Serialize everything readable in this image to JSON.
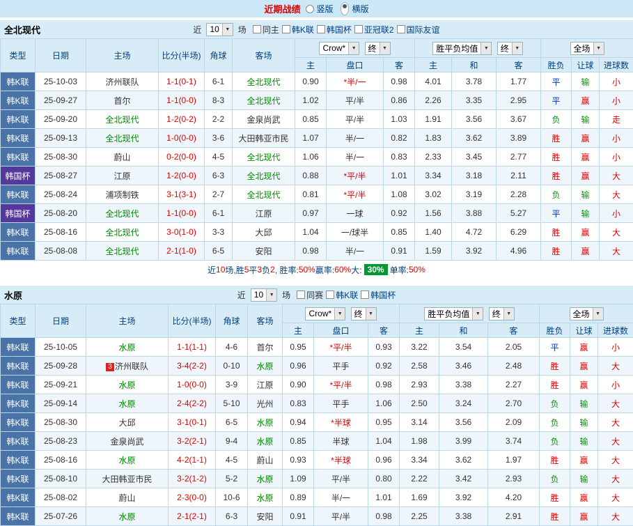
{
  "topbar": {
    "title": "近期战绩",
    "layout_options": [
      {
        "label": "竖版",
        "selected": false
      },
      {
        "label": "横版",
        "selected": true
      }
    ]
  },
  "sections": [
    {
      "team": "全北现代",
      "controls": {
        "near": "近",
        "count": "10",
        "games": "场",
        "filters": [
          {
            "label": "同主",
            "checked": false,
            "type": "plain"
          },
          {
            "label": "韩K联",
            "checked": false,
            "type": "league"
          },
          {
            "label": "韩国杯",
            "checked": false,
            "type": "league"
          },
          {
            "label": "亚冠联2",
            "checked": false,
            "type": "league"
          },
          {
            "label": "国际友谊",
            "checked": false,
            "type": "league"
          }
        ]
      },
      "header": {
        "type": "类型",
        "date": "日期",
        "home": "主场",
        "score": "比分(半场)",
        "corner": "角球",
        "away": "客场",
        "odds_select": "Crow*",
        "odds_final": "终",
        "avg_select": "胜平负均值",
        "avg_final": "终",
        "full_select": "全场",
        "odds_sub": [
          "主",
          "盘口",
          "客"
        ],
        "avg_sub": [
          "主",
          "和",
          "客"
        ],
        "full_sub": [
          "胜负",
          "让球",
          "进球数"
        ]
      },
      "rows": [
        {
          "league": "韩K联",
          "cup": false,
          "date": "25-10-03",
          "home": "济州联队",
          "home_focus": false,
          "badge": "",
          "score": "1-1(0-1)",
          "corner": "6-1",
          "away": "全北现代",
          "away_focus": true,
          "odds_home": "0.90",
          "handicap": "*半/一",
          "handicap_star": true,
          "odds_away": "0.98",
          "avg": [
            "4.01",
            "3.78",
            "1.77"
          ],
          "result": [
            "平",
            "blue"
          ],
          "handicap_result": [
            "输",
            "green"
          ],
          "goals_result": [
            "小",
            "red"
          ]
        },
        {
          "league": "韩K联",
          "cup": false,
          "date": "25-09-27",
          "home": "首尔",
          "home_focus": false,
          "badge": "",
          "score": "1-1(0-0)",
          "corner": "8-3",
          "away": "全北现代",
          "away_focus": true,
          "odds_home": "1.02",
          "handicap": "平/半",
          "handicap_star": false,
          "odds_away": "0.86",
          "avg": [
            "2.26",
            "3.35",
            "2.95"
          ],
          "result": [
            "平",
            "blue"
          ],
          "handicap_result": [
            "赢",
            "red"
          ],
          "goals_result": [
            "小",
            "red"
          ]
        },
        {
          "league": "韩K联",
          "cup": false,
          "date": "25-09-20",
          "home": "全北现代",
          "home_focus": true,
          "badge": "",
          "score": "1-2(0-2)",
          "corner": "2-2",
          "away": "金泉尚武",
          "away_focus": false,
          "odds_home": "0.85",
          "handicap": "平/半",
          "handicap_star": false,
          "odds_away": "1.03",
          "avg": [
            "1.91",
            "3.56",
            "3.67"
          ],
          "result": [
            "负",
            "green"
          ],
          "handicap_result": [
            "输",
            "green"
          ],
          "goals_result": [
            "走",
            "red"
          ]
        },
        {
          "league": "韩K联",
          "cup": false,
          "date": "25-09-13",
          "home": "全北现代",
          "home_focus": true,
          "badge": "",
          "score": "1-0(0-0)",
          "corner": "3-6",
          "away": "大田韩亚市民",
          "away_focus": false,
          "odds_home": "1.07",
          "handicap": "半/一",
          "handicap_star": false,
          "odds_away": "0.82",
          "avg": [
            "1.83",
            "3.62",
            "3.89"
          ],
          "result": [
            "胜",
            "red"
          ],
          "handicap_result": [
            "赢",
            "red"
          ],
          "goals_result": [
            "小",
            "red"
          ]
        },
        {
          "league": "韩K联",
          "cup": false,
          "date": "25-08-30",
          "home": "蔚山",
          "home_focus": false,
          "badge": "",
          "score": "0-2(0-0)",
          "corner": "4-5",
          "away": "全北现代",
          "away_focus": true,
          "odds_home": "1.06",
          "handicap": "半/一",
          "handicap_star": false,
          "odds_away": "0.83",
          "avg": [
            "2.33",
            "3.45",
            "2.77"
          ],
          "result": [
            "胜",
            "red"
          ],
          "handicap_result": [
            "赢",
            "red"
          ],
          "goals_result": [
            "小",
            "red"
          ]
        },
        {
          "league": "韩国杯",
          "cup": true,
          "date": "25-08-27",
          "home": "江原",
          "home_focus": false,
          "badge": "",
          "score": "1-2(0-0)",
          "corner": "6-3",
          "away": "全北现代",
          "away_focus": true,
          "odds_home": "0.88",
          "handicap": "*平/半",
          "handicap_star": true,
          "odds_away": "1.01",
          "avg": [
            "3.34",
            "3.18",
            "2.11"
          ],
          "result": [
            "胜",
            "red"
          ],
          "handicap_result": [
            "赢",
            "red"
          ],
          "goals_result": [
            "大",
            "red"
          ]
        },
        {
          "league": "韩K联",
          "cup": false,
          "date": "25-08-24",
          "home": "浦项制铁",
          "home_focus": false,
          "badge": "",
          "score": "3-1(3-1)",
          "corner": "2-7",
          "away": "全北现代",
          "away_focus": true,
          "odds_home": "0.81",
          "handicap": "*平/半",
          "handicap_star": true,
          "odds_away": "1.08",
          "avg": [
            "3.02",
            "3.19",
            "2.28"
          ],
          "result": [
            "负",
            "green"
          ],
          "handicap_result": [
            "输",
            "green"
          ],
          "goals_result": [
            "大",
            "red"
          ]
        },
        {
          "league": "韩国杯",
          "cup": true,
          "date": "25-08-20",
          "home": "全北现代",
          "home_focus": true,
          "badge": "",
          "score": "1-1(0-0)",
          "corner": "6-1",
          "away": "江原",
          "away_focus": false,
          "odds_home": "0.97",
          "handicap": "一球",
          "handicap_star": false,
          "odds_away": "0.92",
          "avg": [
            "1.56",
            "3.88",
            "5.27"
          ],
          "result": [
            "平",
            "blue"
          ],
          "handicap_result": [
            "输",
            "green"
          ],
          "goals_result": [
            "小",
            "red"
          ]
        },
        {
          "league": "韩K联",
          "cup": false,
          "date": "25-08-16",
          "home": "全北现代",
          "home_focus": true,
          "badge": "",
          "score": "3-0(1-0)",
          "corner": "3-3",
          "away": "大邱",
          "away_focus": false,
          "odds_home": "1.04",
          "handicap": "一/球半",
          "handicap_star": false,
          "odds_away": "0.85",
          "avg": [
            "1.40",
            "4.72",
            "6.29"
          ],
          "result": [
            "胜",
            "red"
          ],
          "handicap_result": [
            "赢",
            "red"
          ],
          "goals_result": [
            "大",
            "red"
          ]
        },
        {
          "league": "韩K联",
          "cup": false,
          "date": "25-08-08",
          "home": "全北现代",
          "home_focus": true,
          "badge": "",
          "score": "2-1(1-0)",
          "corner": "6-5",
          "away": "安阳",
          "away_focus": false,
          "odds_home": "0.98",
          "handicap": "半/一",
          "handicap_star": false,
          "odds_away": "0.91",
          "avg": [
            "1.59",
            "3.92",
            "4.96"
          ],
          "result": [
            "胜",
            "red"
          ],
          "handicap_result": [
            "赢",
            "red"
          ],
          "goals_result": [
            "大",
            "red"
          ]
        }
      ],
      "summary": [
        {
          "text": "近",
          "style": "navy"
        },
        {
          "text": "10",
          "style": "red"
        },
        {
          "text": "场,胜",
          "style": "navy"
        },
        {
          "text": "5",
          "style": "red"
        },
        {
          "text": "平",
          "style": "navy"
        },
        {
          "text": "3",
          "style": "red"
        },
        {
          "text": "负",
          "style": "navy"
        },
        {
          "text": "2",
          "style": "red"
        },
        {
          "text": ", 胜率:",
          "style": "navy"
        },
        {
          "text": "50%",
          "style": "red"
        },
        {
          "text": " 赢率:",
          "style": "navy"
        },
        {
          "text": "60%",
          "style": "red"
        },
        {
          "text": " 大:",
          "style": "navy"
        },
        {
          "text": "30%",
          "style": "badge"
        },
        {
          "text": " 单率:",
          "style": "navy"
        },
        {
          "text": "50%",
          "style": "red"
        }
      ]
    },
    {
      "team": "水原",
      "controls": {
        "near": "近",
        "count": "10",
        "games": "场",
        "filters": [
          {
            "label": "同赛",
            "checked": false,
            "type": "plain"
          },
          {
            "label": "韩K联",
            "checked": false,
            "type": "league"
          },
          {
            "label": "韩国杯",
            "checked": false,
            "type": "league"
          }
        ]
      },
      "header": {
        "type": "类型",
        "date": "日期",
        "home": "主场",
        "score": "比分(半场)",
        "corner": "角球",
        "away": "客场",
        "odds_select": "Crow*",
        "odds_final": "终",
        "avg_select": "胜平负均值",
        "avg_final": "终",
        "full_select": "全场",
        "odds_sub": [
          "主",
          "盘口",
          "客"
        ],
        "avg_sub": [
          "主",
          "和",
          "客"
        ],
        "full_sub": [
          "胜负",
          "让球",
          "进球数"
        ]
      },
      "rows": [
        {
          "league": "韩K联",
          "cup": false,
          "date": "25-10-05",
          "home": "水原",
          "home_focus": true,
          "badge": "",
          "score": "1-1(1-1)",
          "corner": "4-6",
          "away": "首尔",
          "away_focus": false,
          "odds_home": "0.95",
          "handicap": "*平/半",
          "handicap_star": true,
          "odds_away": "0.93",
          "avg": [
            "3.22",
            "3.54",
            "2.05"
          ],
          "result": [
            "平",
            "blue"
          ],
          "handicap_result": [
            "赢",
            "red"
          ],
          "goals_result": [
            "小",
            "red"
          ]
        },
        {
          "league": "韩K联",
          "cup": false,
          "date": "25-09-28",
          "home": "济州联队",
          "home_focus": false,
          "badge": "3",
          "score": "3-4(2-2)",
          "corner": "0-10",
          "away": "水原",
          "away_focus": true,
          "odds_home": "0.96",
          "handicap": "平手",
          "handicap_star": false,
          "odds_away": "0.92",
          "avg": [
            "2.58",
            "3.46",
            "2.48"
          ],
          "result": [
            "胜",
            "red"
          ],
          "handicap_result": [
            "赢",
            "red"
          ],
          "goals_result": [
            "大",
            "red"
          ]
        },
        {
          "league": "韩K联",
          "cup": false,
          "date": "25-09-21",
          "home": "水原",
          "home_focus": true,
          "badge": "",
          "score": "1-0(0-0)",
          "corner": "3-9",
          "away": "江原",
          "away_focus": false,
          "odds_home": "0.90",
          "handicap": "*平/半",
          "handicap_star": true,
          "odds_away": "0.98",
          "avg": [
            "2.93",
            "3.38",
            "2.27"
          ],
          "result": [
            "胜",
            "red"
          ],
          "handicap_result": [
            "赢",
            "red"
          ],
          "goals_result": [
            "小",
            "red"
          ]
        },
        {
          "league": "韩K联",
          "cup": false,
          "date": "25-09-14",
          "home": "水原",
          "home_focus": true,
          "badge": "",
          "score": "2-4(2-2)",
          "corner": "5-10",
          "away": "光州",
          "away_focus": false,
          "odds_home": "0.83",
          "handicap": "平手",
          "handicap_star": false,
          "odds_away": "1.06",
          "avg": [
            "2.50",
            "3.24",
            "2.70"
          ],
          "result": [
            "负",
            "green"
          ],
          "handicap_result": [
            "输",
            "green"
          ],
          "goals_result": [
            "大",
            "red"
          ]
        },
        {
          "league": "韩K联",
          "cup": false,
          "date": "25-08-30",
          "home": "大邱",
          "home_focus": false,
          "badge": "",
          "score": "3-1(0-1)",
          "corner": "6-5",
          "away": "水原",
          "away_focus": true,
          "odds_home": "0.94",
          "handicap": "*半球",
          "handicap_star": true,
          "odds_away": "0.95",
          "avg": [
            "3.14",
            "3.56",
            "2.09"
          ],
          "result": [
            "负",
            "green"
          ],
          "handicap_result": [
            "输",
            "green"
          ],
          "goals_result": [
            "大",
            "red"
          ]
        },
        {
          "league": "韩K联",
          "cup": false,
          "date": "25-08-23",
          "home": "金泉尚武",
          "home_focus": false,
          "badge": "",
          "score": "3-2(2-1)",
          "corner": "9-4",
          "away": "水原",
          "away_focus": true,
          "odds_home": "0.85",
          "handicap": "半球",
          "handicap_star": false,
          "odds_away": "1.04",
          "avg": [
            "1.98",
            "3.99",
            "3.74"
          ],
          "result": [
            "负",
            "green"
          ],
          "handicap_result": [
            "输",
            "green"
          ],
          "goals_result": [
            "大",
            "red"
          ]
        },
        {
          "league": "韩K联",
          "cup": false,
          "date": "25-08-16",
          "home": "水原",
          "home_focus": true,
          "badge": "",
          "score": "4-2(1-1)",
          "corner": "4-5",
          "away": "蔚山",
          "away_focus": false,
          "odds_home": "0.93",
          "handicap": "*半球",
          "handicap_star": true,
          "odds_away": "0.96",
          "avg": [
            "3.34",
            "3.62",
            "1.97"
          ],
          "result": [
            "胜",
            "red"
          ],
          "handicap_result": [
            "赢",
            "red"
          ],
          "goals_result": [
            "大",
            "red"
          ]
        },
        {
          "league": "韩K联",
          "cup": false,
          "date": "25-08-10",
          "home": "大田韩亚市民",
          "home_focus": false,
          "badge": "",
          "score": "3-2(1-2)",
          "corner": "5-2",
          "away": "水原",
          "away_focus": true,
          "odds_home": "1.09",
          "handicap": "平/半",
          "handicap_star": false,
          "odds_away": "0.80",
          "avg": [
            "2.22",
            "3.42",
            "2.93"
          ],
          "result": [
            "负",
            "green"
          ],
          "handicap_result": [
            "输",
            "green"
          ],
          "goals_result": [
            "大",
            "red"
          ]
        },
        {
          "league": "韩K联",
          "cup": false,
          "date": "25-08-02",
          "home": "蔚山",
          "home_focus": false,
          "badge": "",
          "score": "2-3(0-0)",
          "corner": "10-6",
          "away": "水原",
          "away_focus": true,
          "odds_home": "0.89",
          "handicap": "半/一",
          "handicap_star": false,
          "odds_away": "1.01",
          "avg": [
            "1.69",
            "3.92",
            "4.20"
          ],
          "result": [
            "胜",
            "red"
          ],
          "handicap_result": [
            "赢",
            "red"
          ],
          "goals_result": [
            "大",
            "red"
          ]
        },
        {
          "league": "韩K联",
          "cup": false,
          "date": "25-07-26",
          "home": "水原",
          "home_focus": true,
          "badge": "",
          "score": "2-1(2-1)",
          "corner": "6-3",
          "away": "安阳",
          "away_focus": false,
          "odds_home": "0.91",
          "handicap": "平/半",
          "handicap_star": false,
          "odds_away": "0.98",
          "avg": [
            "2.25",
            "3.38",
            "2.91"
          ],
          "result": [
            "胜",
            "red"
          ],
          "handicap_result": [
            "赢",
            "red"
          ],
          "goals_result": [
            "大",
            "red"
          ]
        }
      ]
    }
  ]
}
